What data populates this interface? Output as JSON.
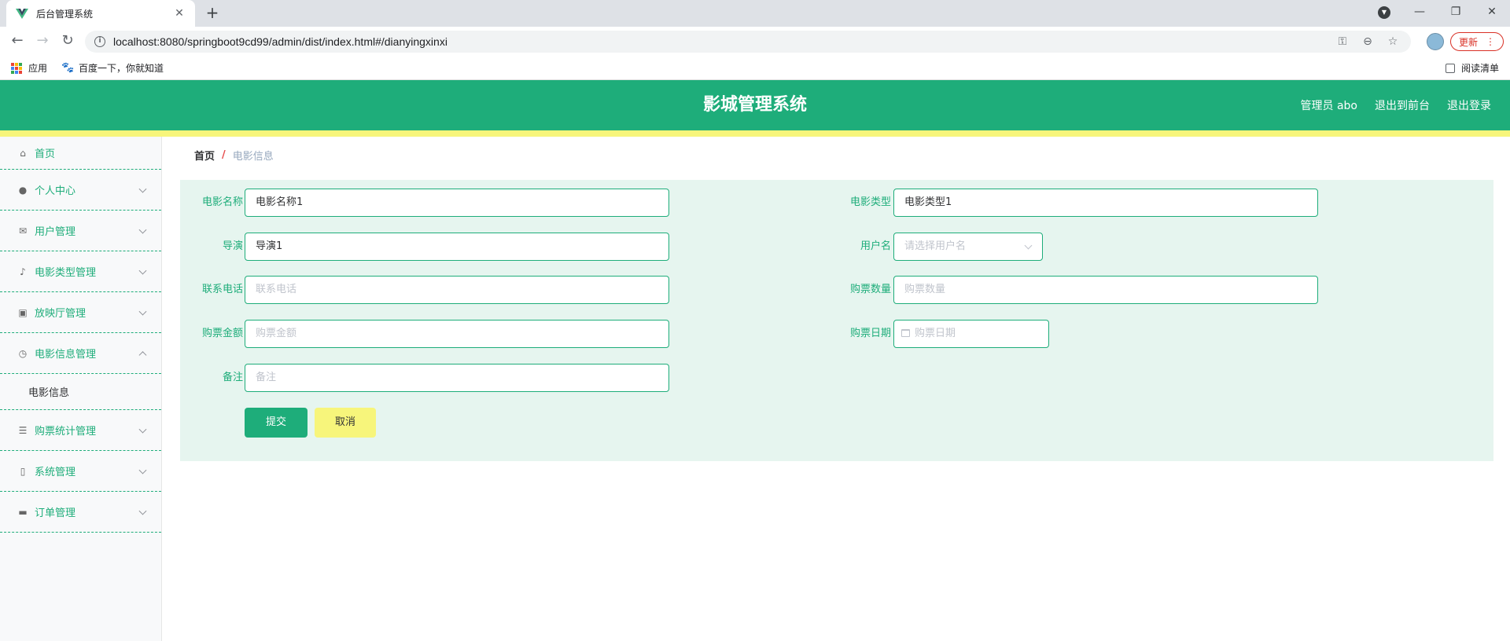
{
  "browser": {
    "tab_title": "后台管理系统",
    "new_tab": "+",
    "url": "localhost:8080/springboot9cd99/admin/dist/index.html#/dianyingxinxi",
    "update_label": "更新",
    "bookmarks": [
      "应用",
      "百度一下，你就知道"
    ],
    "reading_list": "阅读清单"
  },
  "header": {
    "title": "影城管理系统",
    "user": "管理员 abo",
    "front_link": "退出到前台",
    "logout": "退出登录"
  },
  "sidebar": {
    "items": [
      {
        "label": "首页",
        "icon": "home-icon"
      },
      {
        "label": "个人中心",
        "icon": "user-icon"
      },
      {
        "label": "用户管理",
        "icon": "mail-icon"
      },
      {
        "label": "电影类型管理",
        "icon": "microphone-icon"
      },
      {
        "label": "放映厅管理",
        "icon": "clipboard-icon"
      },
      {
        "label": "电影信息管理",
        "icon": "compass-icon"
      },
      {
        "label": "购票统计管理",
        "icon": "sliders-icon"
      },
      {
        "label": "系统管理",
        "icon": "phone-icon"
      },
      {
        "label": "订单管理",
        "icon": "camera-icon"
      }
    ],
    "submenu": [
      "电影信息"
    ]
  },
  "breadcrumb": {
    "home": "首页",
    "separator": "/",
    "current": "电影信息"
  },
  "form": {
    "movie_name_label": "电影名称",
    "movie_name_value": "电影名称1",
    "movie_type_label": "电影类型",
    "movie_type_value": "电影类型1",
    "director_label": "导演",
    "director_value": "导演1",
    "username_label": "用户名",
    "username_placeholder": "请选择用户名",
    "phone_label": "联系电话",
    "phone_placeholder": "联系电话",
    "ticket_count_label": "购票数量",
    "ticket_count_placeholder": "购票数量",
    "ticket_amount_label": "购票金额",
    "ticket_amount_placeholder": "购票金额",
    "ticket_date_label": "购票日期",
    "ticket_date_placeholder": "购票日期",
    "remark_label": "备注",
    "remark_placeholder": "备注",
    "submit": "提交",
    "cancel": "取消"
  },
  "colors": {
    "primary": "#1ead7a",
    "accent_yellow": "#f7f57b",
    "panel": "#e6f5ef"
  }
}
